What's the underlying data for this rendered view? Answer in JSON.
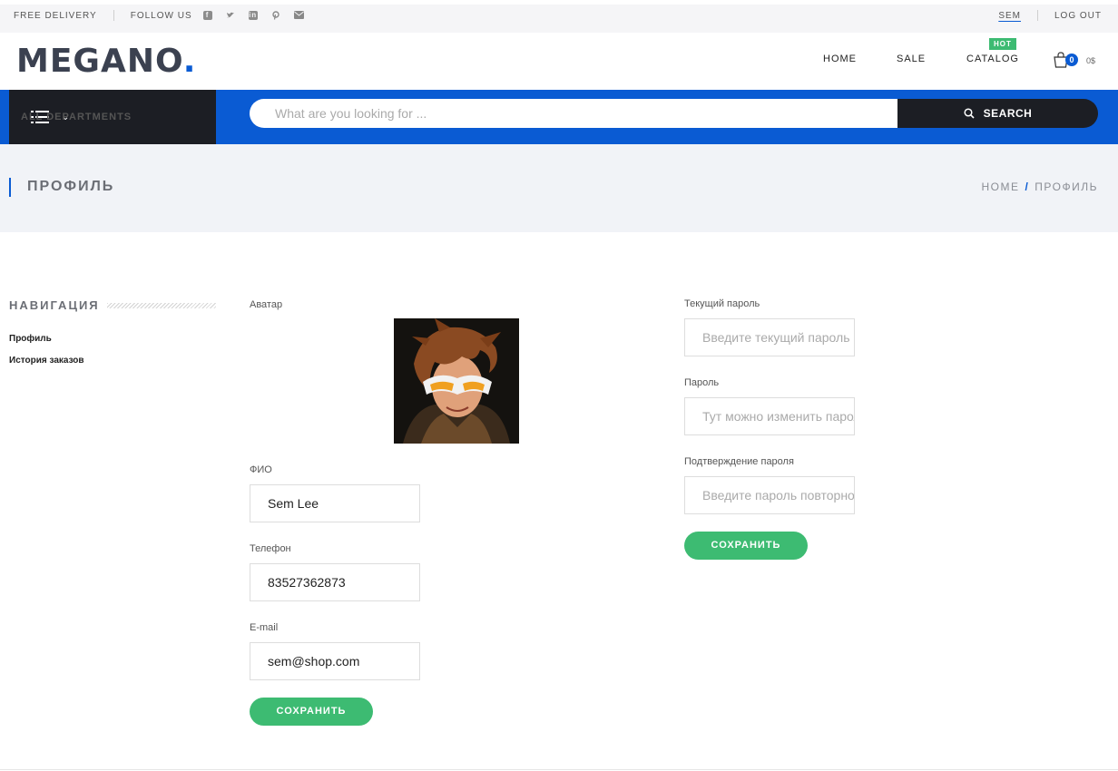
{
  "topbar": {
    "free_delivery": "FREE DELIVERY",
    "follow_us": "FOLLOW US",
    "social_icons": [
      "facebook-icon",
      "twitter-icon",
      "linkedin-icon",
      "pinterest-icon",
      "mail-icon"
    ],
    "user": "SEM",
    "logout": "LOG OUT"
  },
  "header": {
    "logo": "MEGANO",
    "nav": {
      "home": "HOME",
      "sale": "SALE",
      "catalog": "CATALOG",
      "hot_badge": "HOT"
    },
    "cart": {
      "count": "0",
      "total": "0$"
    }
  },
  "searchbar": {
    "departments": "ALL DEPARTMENTS",
    "placeholder": "What are you looking for ...",
    "button": "SEARCH"
  },
  "page": {
    "title": "ПРОФИЛЬ",
    "breadcrumb": {
      "home": "HOME",
      "current": "ПРОФИЛЬ"
    }
  },
  "sidebar": {
    "title": "НАВИГАЦИЯ",
    "items": [
      {
        "label": "Профиль"
      },
      {
        "label": "История заказов"
      }
    ]
  },
  "profile_form": {
    "avatar_label": "Аватар",
    "name_label": "ФИО",
    "name_value": "Sem Lee",
    "phone_label": "Телефон",
    "phone_value": "83527362873",
    "email_label": "E-mail",
    "email_value": "sem@shop.com",
    "save": "СОХРАНИТЬ"
  },
  "password_form": {
    "current_label": "Текущий пароль",
    "current_placeholder": "Введите текущий пароль",
    "new_label": "Пароль",
    "new_placeholder": "Тут можно изменить пароль",
    "confirm_label": "Подтверждение пароля",
    "confirm_placeholder": "Введите пароль повторно",
    "save": "СОХРАНИТЬ"
  },
  "colors": {
    "accent": "#0a5bd3",
    "dark": "#1c1e24",
    "green": "#3dbb72"
  }
}
